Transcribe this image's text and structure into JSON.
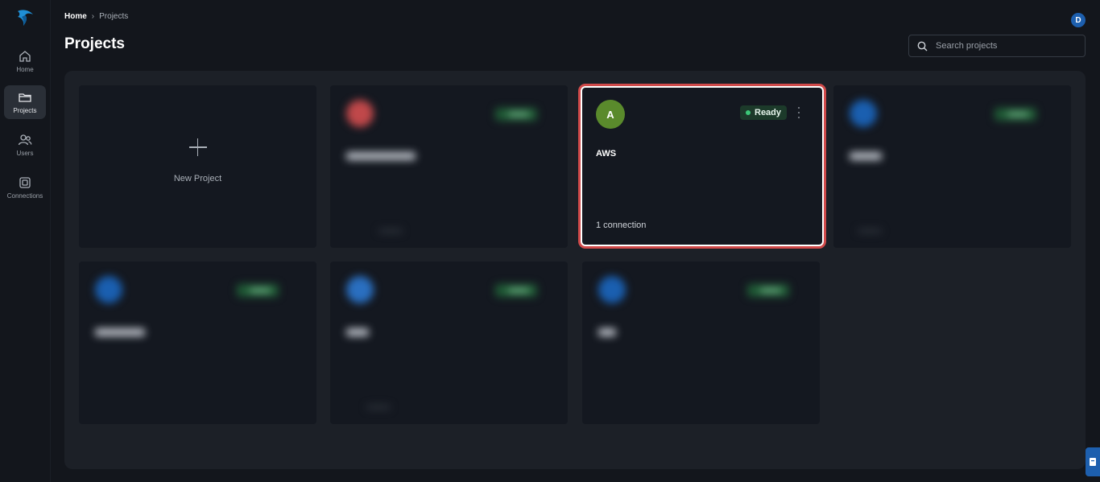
{
  "sidebar": {
    "items": [
      {
        "label": "Home",
        "icon": "home-icon"
      },
      {
        "label": "Projects",
        "icon": "folder-icon",
        "active": true
      },
      {
        "label": "Users",
        "icon": "users-icon"
      },
      {
        "label": "Connections",
        "icon": "connections-icon"
      }
    ]
  },
  "header": {
    "breadcrumb": {
      "home": "Home",
      "current": "Projects"
    },
    "title": "Projects",
    "avatar_initial": "D"
  },
  "search": {
    "placeholder": "Search projects"
  },
  "new_project": {
    "label": "New Project"
  },
  "highlighted_project": {
    "initial": "A",
    "name": "AWS",
    "status": "Ready",
    "connections": "1 connection"
  },
  "colors": {
    "accent": "#1d5fae",
    "status_ready": "#3cc878",
    "highlight_border": "#d04a4a"
  }
}
